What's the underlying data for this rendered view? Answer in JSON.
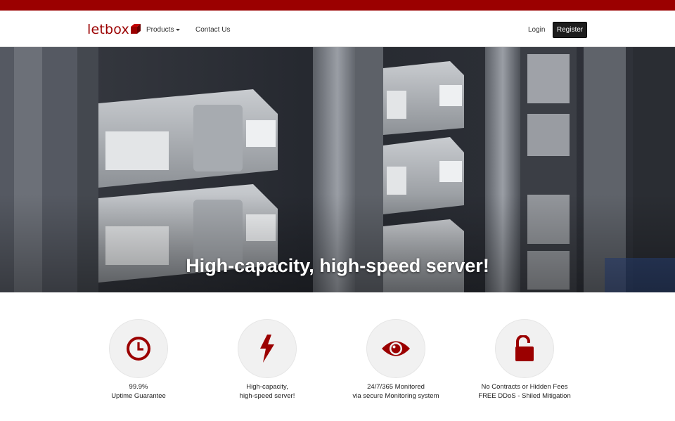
{
  "brand": {
    "name": "letbox",
    "color": "#9b0000"
  },
  "nav": {
    "products_label": "Products",
    "contact_label": "Contact Us",
    "login_label": "Login",
    "register_label": "Register"
  },
  "hero": {
    "title": "High-capacity, high-speed server!"
  },
  "features": [
    {
      "icon": "clock-icon",
      "line1": "99.9%",
      "line2": "Uptime Guarantee"
    },
    {
      "icon": "lightning-icon",
      "line1": "High-capacity,",
      "line2": "high-speed server!"
    },
    {
      "icon": "eye-icon",
      "line1": "24/7/365 Monitored",
      "line2": "via secure Monitoring system"
    },
    {
      "icon": "unlock-icon",
      "line1": "No Contracts or Hidden Fees",
      "line2": "FREE DDoS - Shiled Mitigation"
    }
  ]
}
